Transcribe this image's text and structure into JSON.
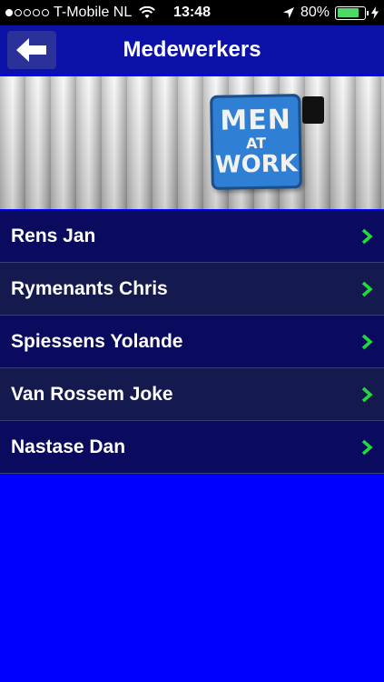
{
  "status_bar": {
    "carrier": "T-Mobile NL",
    "time": "13:48",
    "battery_percent": "80%",
    "battery_level": 0.8,
    "signal_bars_filled": 1,
    "signal_bars_total": 5
  },
  "nav": {
    "title": "Medewerkers",
    "back_icon": "arrow-left-icon"
  },
  "header_image": {
    "sign_line1": "MEN",
    "sign_line2": "AT",
    "sign_line3": "WORK"
  },
  "staff": [
    {
      "name": "Rens Jan"
    },
    {
      "name": "Rymenants Chris"
    },
    {
      "name": "Spiessens Yolande"
    },
    {
      "name": "Van Rossem Joke"
    },
    {
      "name": "Nastase Dan"
    }
  ],
  "colors": {
    "background": "#0000ff",
    "nav_bar": "#0c12a8",
    "list_odd": "#0a0a5e",
    "list_even": "#141a4e",
    "chevron": "#1fdc3a",
    "battery": "#4cd964"
  }
}
